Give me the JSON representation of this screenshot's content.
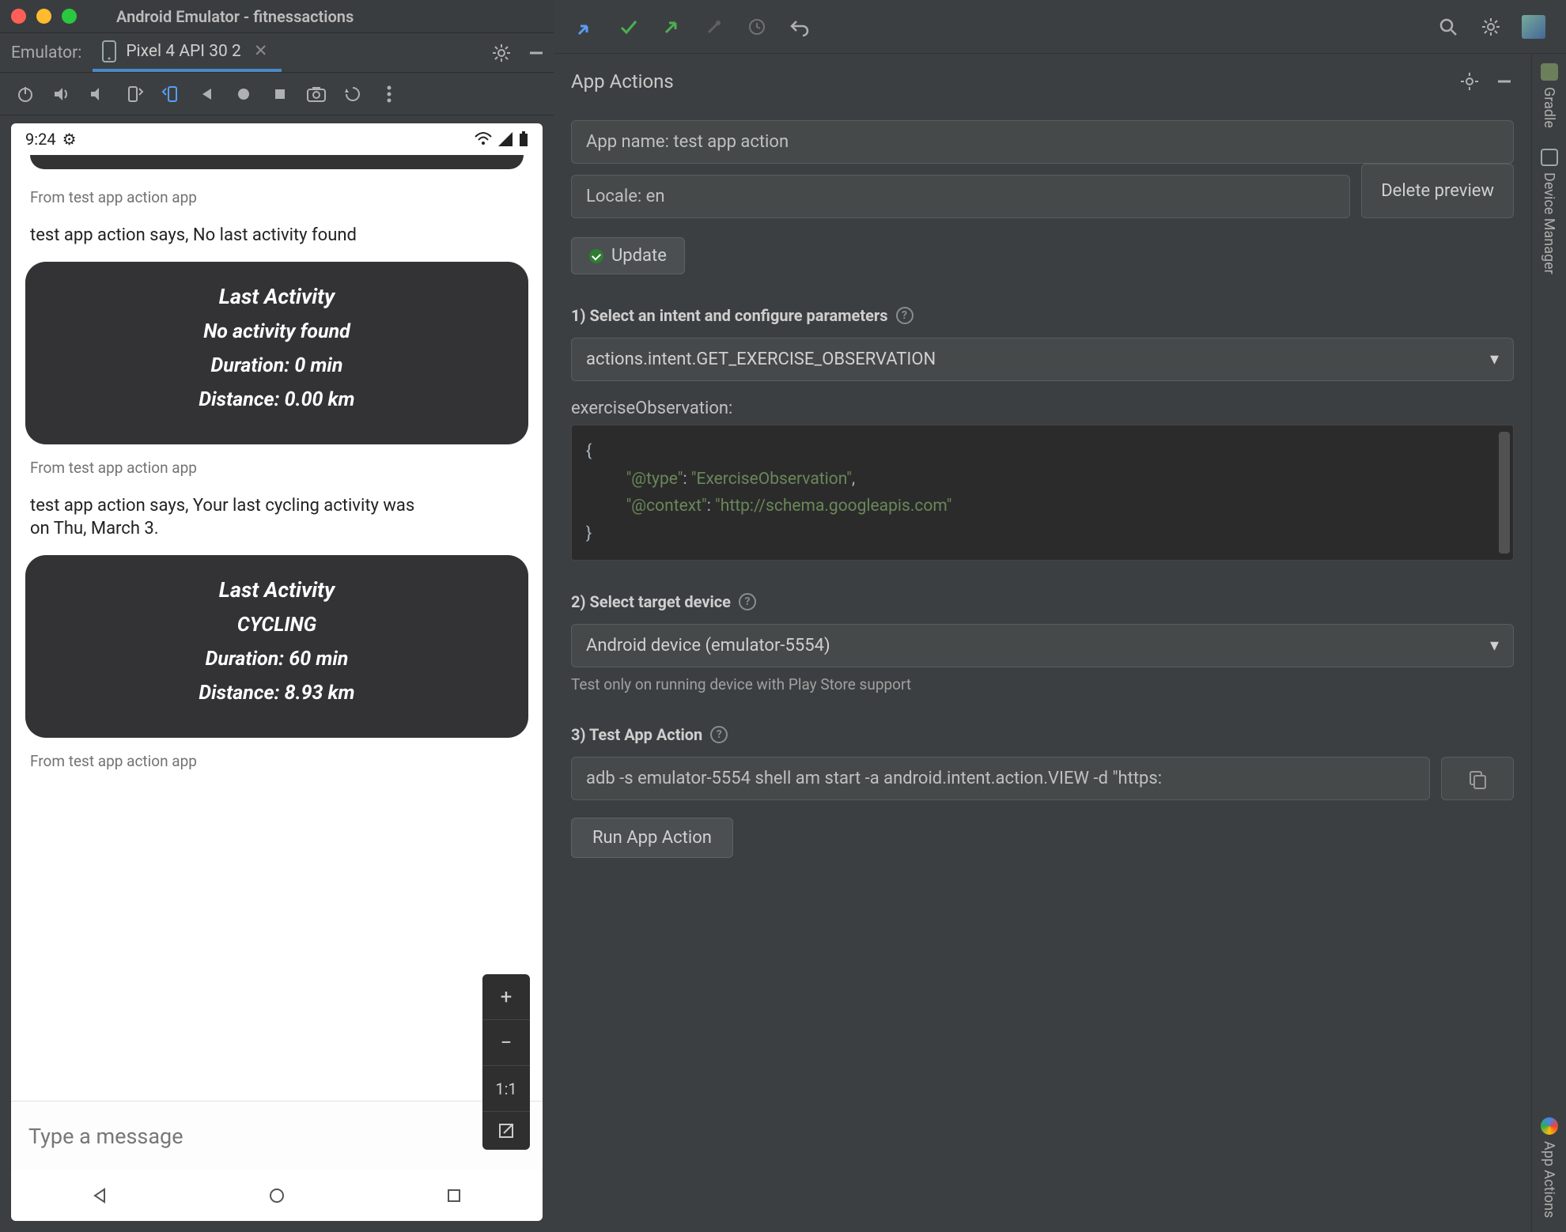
{
  "window": {
    "title": "Android Emulator - fitnessactions",
    "tabLabel": "Emulator:",
    "deviceTab": "Pixel 4 API 30 2"
  },
  "phone": {
    "time": "9:24",
    "messages": [
      {
        "source": "From test app action app",
        "text": "test app action says, No last activity found"
      },
      {
        "source": "From test app action app",
        "text": "test app action says, Your last cycling activity was on Thu, March 3."
      },
      {
        "source": "From test app action app",
        "text": ""
      }
    ],
    "cards": [
      {
        "title": "Last Activity",
        "line1": "No activity found",
        "duration": "Duration: 0 min",
        "distance": "Distance: 0.00 km"
      },
      {
        "title": "Last Activity",
        "line1": "CYCLING",
        "duration": "Duration: 60 min",
        "distance": "Distance: 8.93 km"
      }
    ],
    "composerPlaceholder": "Type a message",
    "zoomOneToOne": "1:1"
  },
  "appActions": {
    "panelTitle": "App Actions",
    "appNameField": "App name: test app action",
    "localeField": "Locale: en",
    "deletePreview": "Delete preview",
    "updateLabel": "Update",
    "steps": {
      "s1": "1) Select an intent and configure parameters",
      "s2": "2) Select target device",
      "s3": "3) Test App Action"
    },
    "intentSelected": "actions.intent.GET_EXERCISE_OBSERVATION",
    "paramLabel": "exerciseObservation:",
    "jsonLines": {
      "open": "{",
      "l1k": "\"@type\"",
      "l1c": ": ",
      "l1v": "\"ExerciseObservation\"",
      "l1e": ",",
      "l2k": "\"@context\"",
      "l2c": ": ",
      "l2v": "\"http://schema.googleapis.com\"",
      "close": "}"
    },
    "deviceSelected": "Android device (emulator-5554)",
    "deviceHint": "Test only on running device with Play Store support",
    "adbCommand": "adb -s emulator-5554 shell am start -a android.intent.action.VIEW -d \"https:",
    "runLabel": "Run App Action"
  },
  "rail": {
    "gradle": "Gradle",
    "deviceManager": "Device Manager",
    "appActions": "App Actions"
  }
}
